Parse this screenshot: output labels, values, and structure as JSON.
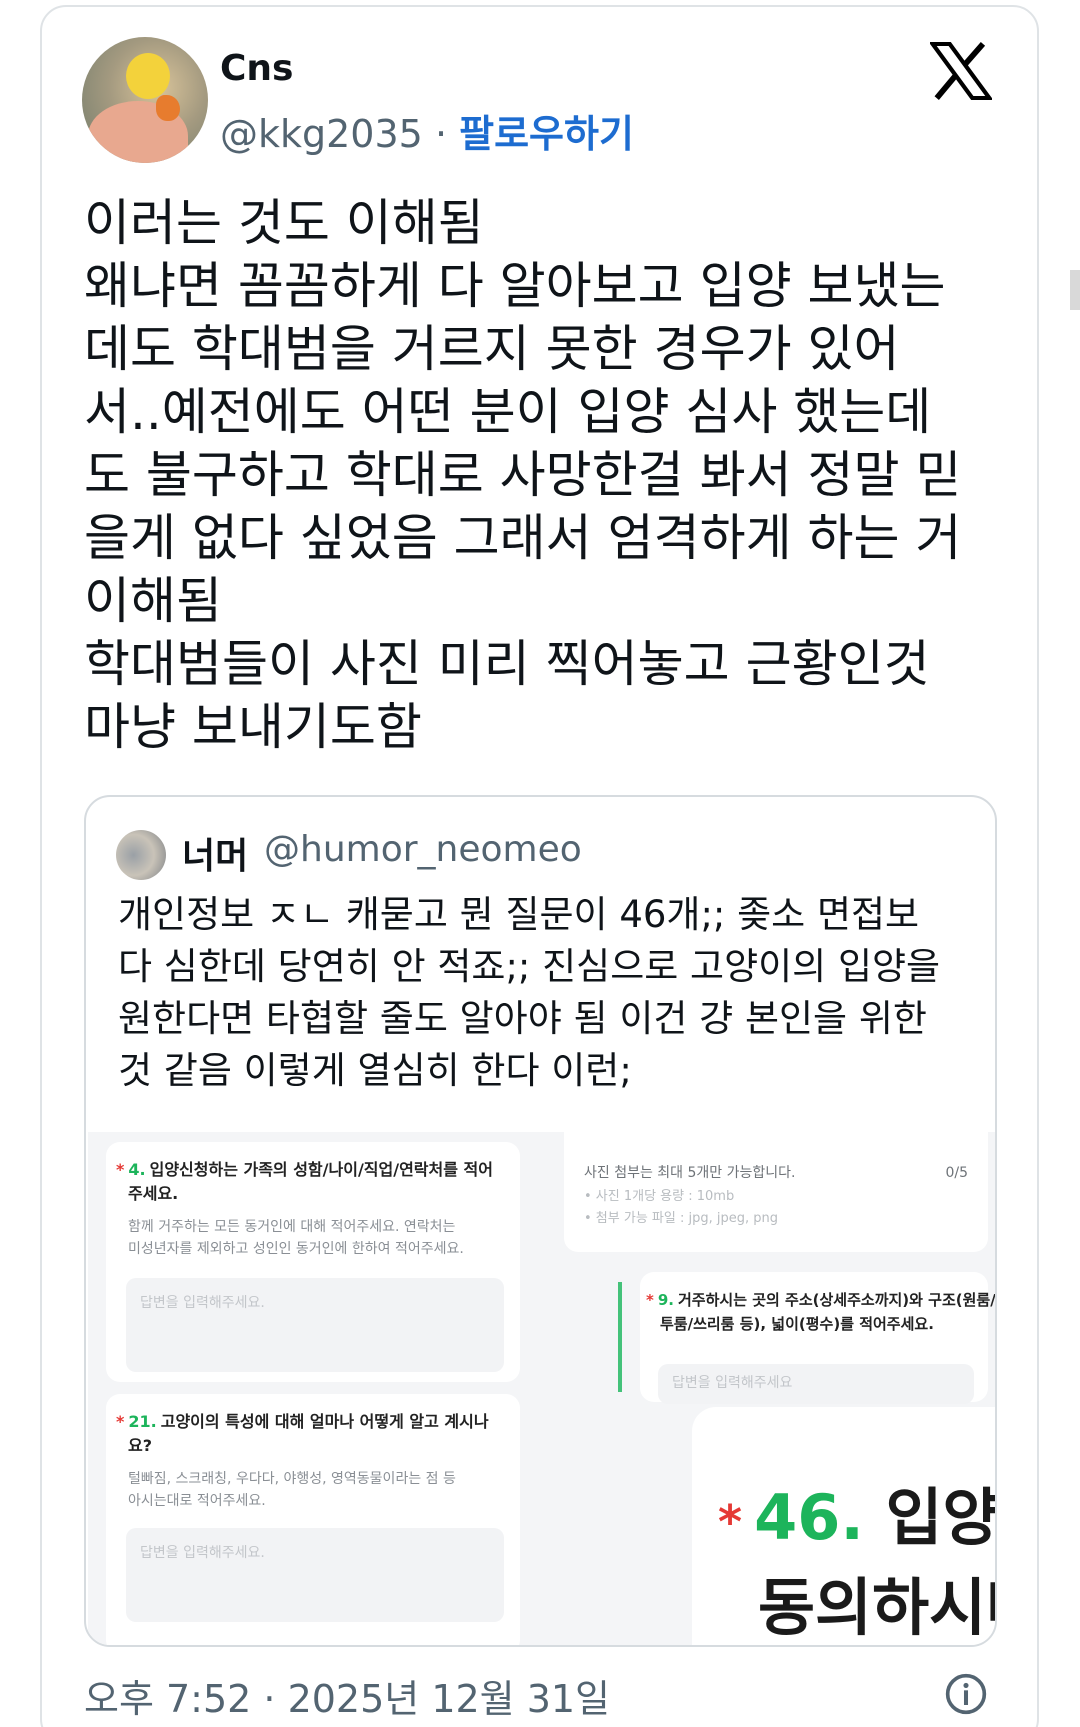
{
  "tweet": {
    "author_name": "Cns",
    "author_handle": "@kkg2035",
    "separator": "·",
    "follow_label": "팔로우하기",
    "text_lines": [
      "이러는 것도 이해됨",
      "왜냐면 꼼꼼하게 다 알아보고 입양 보냈는",
      "데도 학대범을 거르지 못한 경우가 있어",
      "서..예전에도 어떤 분이 입양 심사 했는데",
      "도 불구하고 학대로 사망한걸 봐서 정말 믿",
      "을게 없다 싶었음 그래서 엄격하게 하는 거",
      "이해됨",
      "학대범들이 사진 미리 찍어놓고 근황인것",
      "마냥 보내기도함"
    ],
    "timestamp": "오후 7:52 · 2025년 12월 31일"
  },
  "quote": {
    "author_name": "너머",
    "author_handle": "@humor_neomeo",
    "text_lines": [
      "개인정보 ㅈㄴ 캐묻고 뭔 질문이 46개;; 좆소 면접보",
      "다 심한데 당연히 안 적죠;; 진심으로 고양이의 입양을",
      "원한다면 타협할 줄도 알아야 됨 이건 걍 본인을 위한",
      "것 같음 이렇게 열심히 한다 이런;"
    ]
  },
  "form": {
    "star": "*",
    "q4": {
      "num": "4.",
      "title_line1": "입양신청하는 가족의 성함/나이/직업/연락처를 적어",
      "title_line2": "주세요.",
      "desc_line1": "함께 거주하는 모든 동거인에 대해 적어주세요. 연락처는",
      "desc_line2": "미성년자를 제외하고 성인인 동거인에 한하여 적어주세요.",
      "placeholder": "답변을 입력해주세요."
    },
    "photo": {
      "notice": "사진 첨부는 최대 5개만 가능합니다.",
      "count": "0/5",
      "size_note": "• 사진 1개당 용량 : 10mb",
      "type_note": "• 첨부 가능 파일 : jpg, jpeg, png"
    },
    "q9": {
      "num": "9.",
      "title_line1": "거주하시는 곳의 주소(상세주소까지)와 구조(원룸/",
      "title_line2": "투룸/쓰리룸 등), 넓이(평수)를 적어주세요.",
      "placeholder": "답변을 입력해주세요"
    },
    "q21": {
      "num": "21.",
      "title_line1": "고양이의 특성에 대해 얼마나 어떻게 알고 계시나",
      "title_line2": "요?",
      "desc_line1": "털빠짐, 스크래칭, 우다다, 야행성, 영역동물이라는 점 등",
      "desc_line2": "아시는대로 적어주세요.",
      "placeholder": "답변을 입력해주세요."
    },
    "q46": {
      "num": "46.",
      "title_line1": "입양시 규",
      "title_line2": "동의하시나요"
    }
  },
  "icons": {
    "platform_logo": "x-logo-icon",
    "info": "info-icon"
  },
  "colors": {
    "follow_blue": "#1d6cd0",
    "secondary_text": "#536471",
    "form_green": "#1db45b",
    "form_red": "#e53935"
  }
}
